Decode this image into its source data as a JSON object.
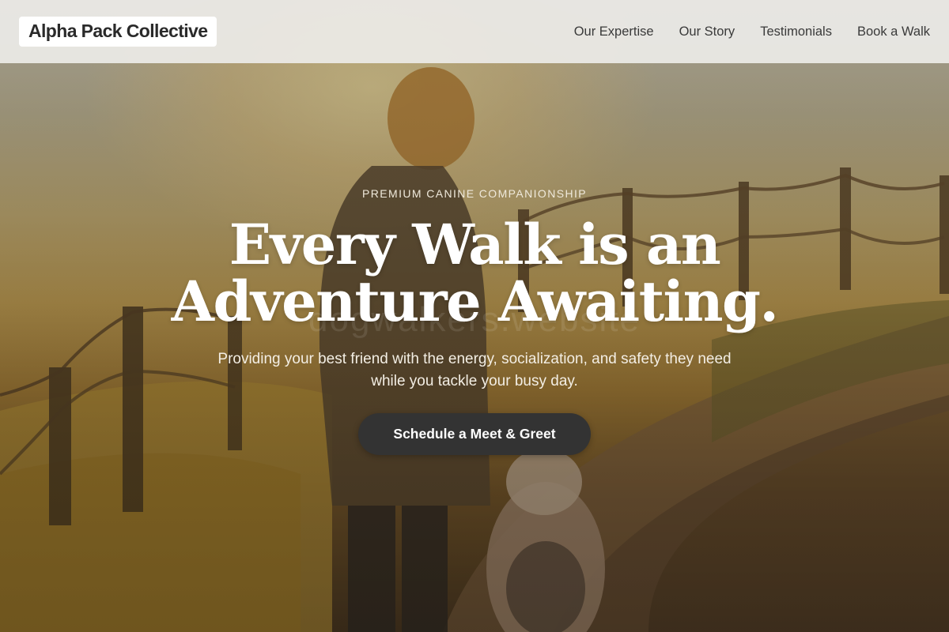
{
  "header": {
    "brand": "Alpha Pack Collective",
    "nav": [
      {
        "label": "Our Expertise"
      },
      {
        "label": "Our Story"
      },
      {
        "label": "Testimonials"
      },
      {
        "label": "Book a Walk"
      }
    ]
  },
  "hero": {
    "eyebrow": "PREMIUM CANINE COMPANIONSHIP",
    "headline_line1": "Every Walk is an",
    "headline_line2": "Adventure Awaiting.",
    "subtext": "Providing your best friend with the energy, socialization, and safety they need while you tackle your busy day.",
    "cta_label": "Schedule a Meet & Greet",
    "watermark": "dogwalkers.website"
  },
  "colors": {
    "header_bg": "#ECEBE7",
    "cta_bg": "#333333",
    "headline": "#FFFFFF"
  }
}
